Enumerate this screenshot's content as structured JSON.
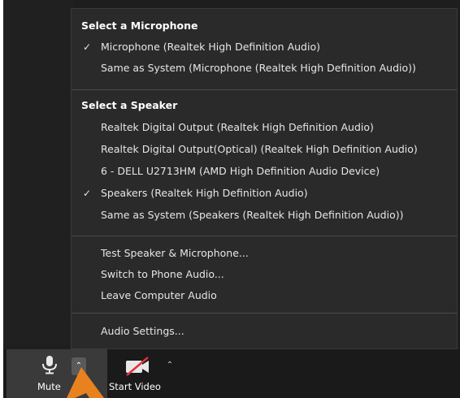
{
  "menu": {
    "mic_heading": "Select a Microphone",
    "mic_items": [
      {
        "label": "Microphone (Realtek High Definition Audio)",
        "checked": true
      },
      {
        "label": "Same as System (Microphone (Realtek High Definition Audio))",
        "checked": false
      }
    ],
    "speaker_heading": "Select a Speaker",
    "speaker_items": [
      {
        "label": "Realtek Digital Output (Realtek High Definition Audio)",
        "checked": false
      },
      {
        "label": "Realtek Digital Output(Optical) (Realtek High Definition Audio)",
        "checked": false
      },
      {
        "label": "6 - DELL U2713HM (AMD High Definition Audio Device)",
        "checked": false
      },
      {
        "label": "Speakers (Realtek High Definition Audio)",
        "checked": true
      },
      {
        "label": "Same as System (Speakers (Realtek High Definition Audio))",
        "checked": false
      }
    ],
    "actions": [
      {
        "label": "Test Speaker & Microphone..."
      },
      {
        "label": "Switch to Phone Audio..."
      },
      {
        "label": "Leave Computer Audio"
      }
    ],
    "settings_label": "Audio Settings...",
    "check_glyph": "✓"
  },
  "toolbar": {
    "mute_label": "Mute",
    "start_video_label": "Start Video",
    "caret_glyph": "⌃"
  },
  "colors": {
    "menu_bg": "#2a2a2a",
    "toolbar_bg": "#1a1a1a",
    "arrow": "#e8821e",
    "video_slash": "#e0313b"
  }
}
